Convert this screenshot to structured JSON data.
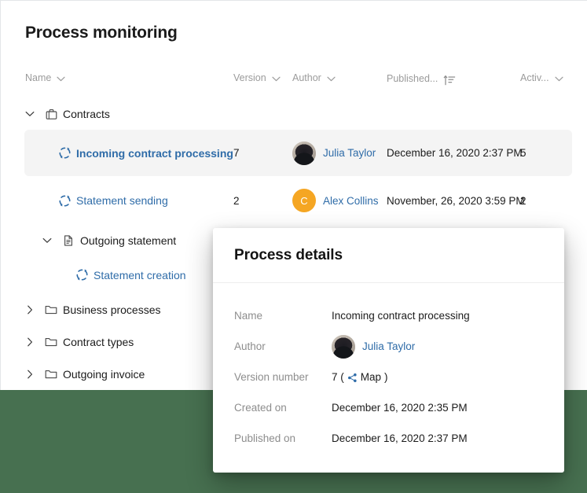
{
  "page": {
    "title": "Process monitoring",
    "background_color": "#477050",
    "accent_link_color": "#2f6ca8",
    "highlight_row_color": "#f4f4f4",
    "avatar_initial_color": "#f5a623"
  },
  "table": {
    "columns": [
      {
        "label": "Name",
        "icon": "chevron-down-icon"
      },
      {
        "label": "Version",
        "icon": "chevron-down-icon"
      },
      {
        "label": "Author",
        "icon": "chevron-down-icon"
      },
      {
        "label": "Published...",
        "icon": "sort-ascending-icon"
      },
      {
        "label": "Activ...",
        "icon": "chevron-down-icon"
      }
    ]
  },
  "tree": {
    "nodes": [
      {
        "label": "Contracts",
        "icon": "briefcase-icon",
        "twisty": "chevron-down-icon",
        "type": "folder"
      },
      {
        "label": "Incoming contract processing",
        "icon": "process-loop-icon",
        "type": "process",
        "selected": true,
        "version": "7",
        "author": "Julia Taylor",
        "author_avatar": "photo",
        "published": "December 16, 2020 2:37 PM",
        "activity": "5"
      },
      {
        "label": "Statement sending",
        "icon": "process-loop-icon",
        "type": "process",
        "selected": false,
        "version": "2",
        "author": "Alex Collins",
        "author_avatar": "initial",
        "author_initial": "C",
        "published": "November, 26, 2020 3:59 PM",
        "activity": "2"
      },
      {
        "label": "Outgoing statement",
        "icon": "document-icon",
        "twisty": "chevron-down-icon",
        "type": "document"
      },
      {
        "label": "Statement creation",
        "icon": "process-loop-icon",
        "type": "process-child"
      },
      {
        "label": "Business processes",
        "icon": "folder-icon",
        "twisty": "chevron-right-icon",
        "type": "folder"
      },
      {
        "label": "Contract types",
        "icon": "folder-icon",
        "twisty": "chevron-right-icon",
        "type": "folder"
      },
      {
        "label": "Outgoing invoice",
        "icon": "folder-icon",
        "twisty": "chevron-right-icon",
        "type": "folder"
      }
    ]
  },
  "details": {
    "title": "Process details",
    "rows": [
      {
        "label": "Name",
        "value": "Incoming contract processing"
      },
      {
        "label": "Author",
        "value": "Julia Taylor"
      },
      {
        "label": "Version number",
        "value": "7"
      },
      {
        "label": "Created on",
        "value": "December 16, 2020  2:35 PM"
      },
      {
        "label": "Published on",
        "value": "December 16, 2020 2:37 PM"
      }
    ],
    "version_prefix": "7 (",
    "version_map_label": "Map",
    "version_suffix": ")",
    "map_icon": "share-network-icon"
  }
}
